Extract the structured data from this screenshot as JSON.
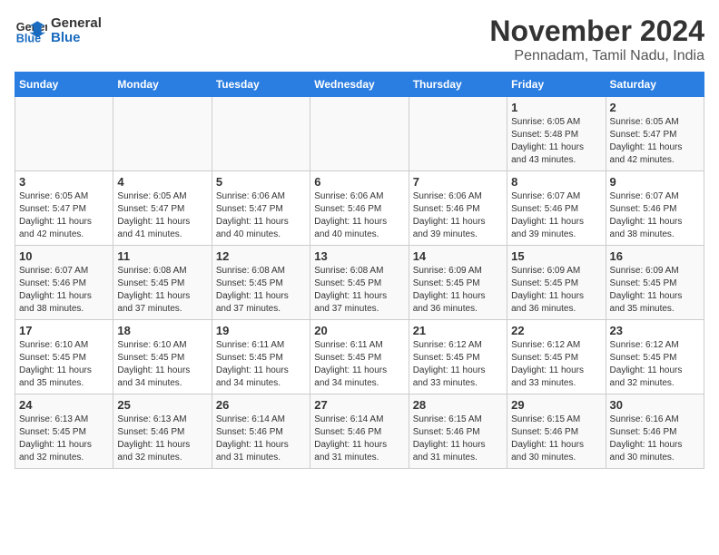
{
  "logo": {
    "line1": "General",
    "line2": "Blue"
  },
  "header": {
    "month": "November 2024",
    "location": "Pennadam, Tamil Nadu, India"
  },
  "weekdays": [
    "Sunday",
    "Monday",
    "Tuesday",
    "Wednesday",
    "Thursday",
    "Friday",
    "Saturday"
  ],
  "weeks": [
    [
      {
        "day": "",
        "info": ""
      },
      {
        "day": "",
        "info": ""
      },
      {
        "day": "",
        "info": ""
      },
      {
        "day": "",
        "info": ""
      },
      {
        "day": "",
        "info": ""
      },
      {
        "day": "1",
        "info": "Sunrise: 6:05 AM\nSunset: 5:48 PM\nDaylight: 11 hours\nand 43 minutes."
      },
      {
        "day": "2",
        "info": "Sunrise: 6:05 AM\nSunset: 5:47 PM\nDaylight: 11 hours\nand 42 minutes."
      }
    ],
    [
      {
        "day": "3",
        "info": "Sunrise: 6:05 AM\nSunset: 5:47 PM\nDaylight: 11 hours\nand 42 minutes."
      },
      {
        "day": "4",
        "info": "Sunrise: 6:05 AM\nSunset: 5:47 PM\nDaylight: 11 hours\nand 41 minutes."
      },
      {
        "day": "5",
        "info": "Sunrise: 6:06 AM\nSunset: 5:47 PM\nDaylight: 11 hours\nand 40 minutes."
      },
      {
        "day": "6",
        "info": "Sunrise: 6:06 AM\nSunset: 5:46 PM\nDaylight: 11 hours\nand 40 minutes."
      },
      {
        "day": "7",
        "info": "Sunrise: 6:06 AM\nSunset: 5:46 PM\nDaylight: 11 hours\nand 39 minutes."
      },
      {
        "day": "8",
        "info": "Sunrise: 6:07 AM\nSunset: 5:46 PM\nDaylight: 11 hours\nand 39 minutes."
      },
      {
        "day": "9",
        "info": "Sunrise: 6:07 AM\nSunset: 5:46 PM\nDaylight: 11 hours\nand 38 minutes."
      }
    ],
    [
      {
        "day": "10",
        "info": "Sunrise: 6:07 AM\nSunset: 5:46 PM\nDaylight: 11 hours\nand 38 minutes."
      },
      {
        "day": "11",
        "info": "Sunrise: 6:08 AM\nSunset: 5:45 PM\nDaylight: 11 hours\nand 37 minutes."
      },
      {
        "day": "12",
        "info": "Sunrise: 6:08 AM\nSunset: 5:45 PM\nDaylight: 11 hours\nand 37 minutes."
      },
      {
        "day": "13",
        "info": "Sunrise: 6:08 AM\nSunset: 5:45 PM\nDaylight: 11 hours\nand 37 minutes."
      },
      {
        "day": "14",
        "info": "Sunrise: 6:09 AM\nSunset: 5:45 PM\nDaylight: 11 hours\nand 36 minutes."
      },
      {
        "day": "15",
        "info": "Sunrise: 6:09 AM\nSunset: 5:45 PM\nDaylight: 11 hours\nand 36 minutes."
      },
      {
        "day": "16",
        "info": "Sunrise: 6:09 AM\nSunset: 5:45 PM\nDaylight: 11 hours\nand 35 minutes."
      }
    ],
    [
      {
        "day": "17",
        "info": "Sunrise: 6:10 AM\nSunset: 5:45 PM\nDaylight: 11 hours\nand 35 minutes."
      },
      {
        "day": "18",
        "info": "Sunrise: 6:10 AM\nSunset: 5:45 PM\nDaylight: 11 hours\nand 34 minutes."
      },
      {
        "day": "19",
        "info": "Sunrise: 6:11 AM\nSunset: 5:45 PM\nDaylight: 11 hours\nand 34 minutes."
      },
      {
        "day": "20",
        "info": "Sunrise: 6:11 AM\nSunset: 5:45 PM\nDaylight: 11 hours\nand 34 minutes."
      },
      {
        "day": "21",
        "info": "Sunrise: 6:12 AM\nSunset: 5:45 PM\nDaylight: 11 hours\nand 33 minutes."
      },
      {
        "day": "22",
        "info": "Sunrise: 6:12 AM\nSunset: 5:45 PM\nDaylight: 11 hours\nand 33 minutes."
      },
      {
        "day": "23",
        "info": "Sunrise: 6:12 AM\nSunset: 5:45 PM\nDaylight: 11 hours\nand 32 minutes."
      }
    ],
    [
      {
        "day": "24",
        "info": "Sunrise: 6:13 AM\nSunset: 5:45 PM\nDaylight: 11 hours\nand 32 minutes."
      },
      {
        "day": "25",
        "info": "Sunrise: 6:13 AM\nSunset: 5:46 PM\nDaylight: 11 hours\nand 32 minutes."
      },
      {
        "day": "26",
        "info": "Sunrise: 6:14 AM\nSunset: 5:46 PM\nDaylight: 11 hours\nand 31 minutes."
      },
      {
        "day": "27",
        "info": "Sunrise: 6:14 AM\nSunset: 5:46 PM\nDaylight: 11 hours\nand 31 minutes."
      },
      {
        "day": "28",
        "info": "Sunrise: 6:15 AM\nSunset: 5:46 PM\nDaylight: 11 hours\nand 31 minutes."
      },
      {
        "day": "29",
        "info": "Sunrise: 6:15 AM\nSunset: 5:46 PM\nDaylight: 11 hours\nand 30 minutes."
      },
      {
        "day": "30",
        "info": "Sunrise: 6:16 AM\nSunset: 5:46 PM\nDaylight: 11 hours\nand 30 minutes."
      }
    ]
  ]
}
